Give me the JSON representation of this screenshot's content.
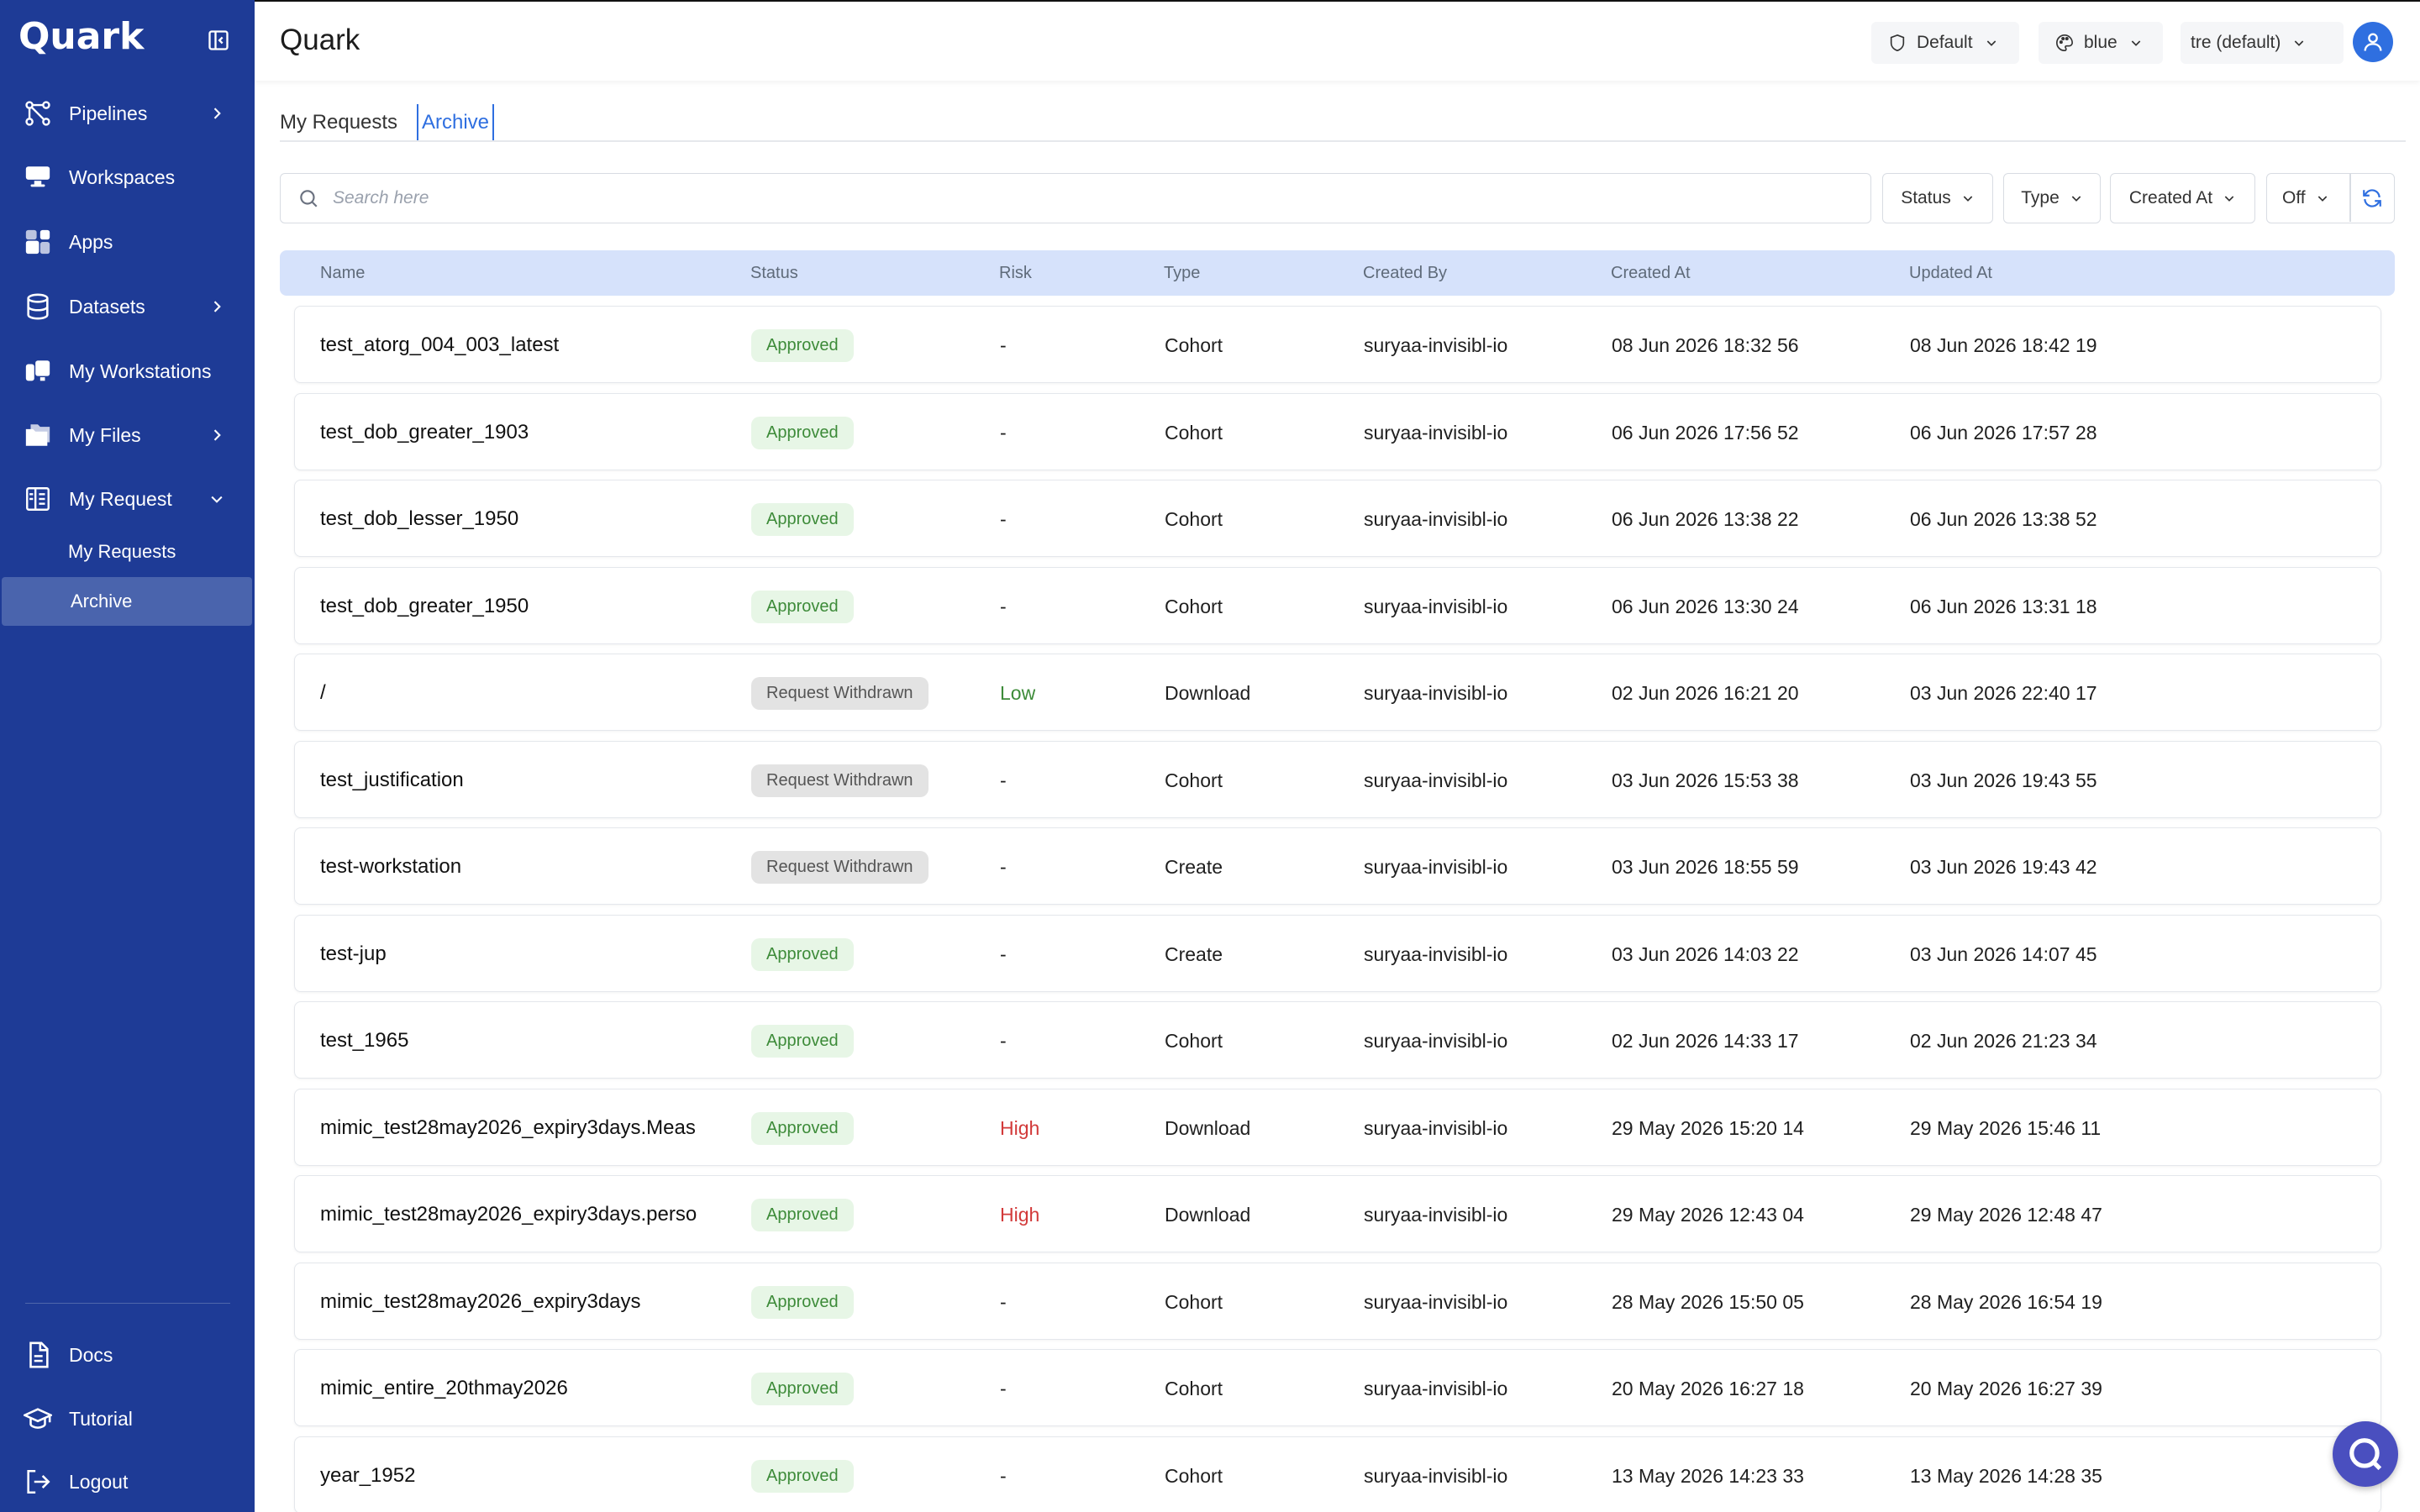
{
  "app": {
    "brand": "Quark",
    "page_title": "Quark"
  },
  "sidebar": {
    "items": [
      {
        "label": "Pipelines",
        "icon": "pipelines-icon",
        "expandable": true
      },
      {
        "label": "Workspaces",
        "icon": "workspaces-icon",
        "expandable": false
      },
      {
        "label": "Apps",
        "icon": "apps-icon",
        "expandable": false
      },
      {
        "label": "Datasets",
        "icon": "datasets-icon",
        "expandable": true
      },
      {
        "label": "My Workstations",
        "icon": "workstations-icon",
        "expandable": false
      },
      {
        "label": "My Files",
        "icon": "files-icon",
        "expandable": true
      },
      {
        "label": "My Request",
        "icon": "request-icon",
        "expandable": true,
        "expanded": true
      }
    ],
    "sub_items": [
      {
        "label": "My Requests",
        "active": false
      },
      {
        "label": "Archive",
        "active": true
      }
    ],
    "bottom_items": [
      {
        "label": "Docs",
        "icon": "docs-icon"
      },
      {
        "label": "Tutorial",
        "icon": "tutorial-icon"
      },
      {
        "label": "Logout",
        "icon": "logout-icon"
      }
    ]
  },
  "header": {
    "policy_select": "Default",
    "theme_select": "blue",
    "tenant_select": "tre (default)"
  },
  "tabs": [
    {
      "label": "My Requests",
      "active": false
    },
    {
      "label": "Archive",
      "active": true
    }
  ],
  "filters": {
    "search_placeholder": "Search here",
    "status": "Status",
    "type": "Type",
    "created_at": "Created At",
    "auto_refresh": "Off"
  },
  "table": {
    "columns": [
      "Name",
      "Status",
      "Risk",
      "Type",
      "Created By",
      "Created At",
      "Updated At"
    ],
    "rows": [
      {
        "name": "test_atorg_004_003_latest",
        "status": "Approved",
        "risk": "-",
        "type": "Cohort",
        "created_by": "suryaa-invisibl-io",
        "created_at": "08 Jun 2026 18:32 56",
        "updated_at": "08 Jun 2026 18:42 19"
      },
      {
        "name": "test_dob_greater_1903",
        "status": "Approved",
        "risk": "-",
        "type": "Cohort",
        "created_by": "suryaa-invisibl-io",
        "created_at": "06 Jun 2026 17:56 52",
        "updated_at": "06 Jun 2026 17:57 28"
      },
      {
        "name": "test_dob_lesser_1950",
        "status": "Approved",
        "risk": "-",
        "type": "Cohort",
        "created_by": "suryaa-invisibl-io",
        "created_at": "06 Jun 2026 13:38 22",
        "updated_at": "06 Jun 2026 13:38 52"
      },
      {
        "name": "test_dob_greater_1950",
        "status": "Approved",
        "risk": "-",
        "type": "Cohort",
        "created_by": "suryaa-invisibl-io",
        "created_at": "06 Jun 2026 13:30 24",
        "updated_at": "06 Jun 2026 13:31 18"
      },
      {
        "name": "/",
        "status": "Request Withdrawn",
        "risk": "Low",
        "type": "Download",
        "created_by": "suryaa-invisibl-io",
        "created_at": "02 Jun 2026 16:21 20",
        "updated_at": "03 Jun 2026 22:40 17"
      },
      {
        "name": "test_justification",
        "status": "Request Withdrawn",
        "risk": "-",
        "type": "Cohort",
        "created_by": "suryaa-invisibl-io",
        "created_at": "03 Jun 2026 15:53 38",
        "updated_at": "03 Jun 2026 19:43 55"
      },
      {
        "name": "test-workstation",
        "status": "Request Withdrawn",
        "risk": "-",
        "type": "Create",
        "created_by": "suryaa-invisibl-io",
        "created_at": "03 Jun 2026 18:55 59",
        "updated_at": "03 Jun 2026 19:43 42"
      },
      {
        "name": "test-jup",
        "status": "Approved",
        "risk": "-",
        "type": "Create",
        "created_by": "suryaa-invisibl-io",
        "created_at": "03 Jun 2026 14:03 22",
        "updated_at": "03 Jun 2026 14:07 45"
      },
      {
        "name": "test_1965",
        "status": "Approved",
        "risk": "-",
        "type": "Cohort",
        "created_by": "suryaa-invisibl-io",
        "created_at": "02 Jun 2026 14:33 17",
        "updated_at": "02 Jun 2026 21:23 34"
      },
      {
        "name": "mimic_test28may2026_expiry3days.Meas",
        "status": "Approved",
        "risk": "High",
        "type": "Download",
        "created_by": "suryaa-invisibl-io",
        "created_at": "29 May 2026 15:20 14",
        "updated_at": "29 May 2026 15:46 11"
      },
      {
        "name": "mimic_test28may2026_expiry3days.perso",
        "status": "Approved",
        "risk": "High",
        "type": "Download",
        "created_by": "suryaa-invisibl-io",
        "created_at": "29 May 2026 12:43 04",
        "updated_at": "29 May 2026 12:48 47"
      },
      {
        "name": "mimic_test28may2026_expiry3days",
        "status": "Approved",
        "risk": "-",
        "type": "Cohort",
        "created_by": "suryaa-invisibl-io",
        "created_at": "28 May 2026 15:50 05",
        "updated_at": "28 May 2026 16:54 19"
      },
      {
        "name": "mimic_entire_20thmay2026",
        "status": "Approved",
        "risk": "-",
        "type": "Cohort",
        "created_by": "suryaa-invisibl-io",
        "created_at": "20 May 2026 16:27 18",
        "updated_at": "20 May 2026 16:27 39"
      },
      {
        "name": "year_1952",
        "status": "Approved",
        "risk": "-",
        "type": "Cohort",
        "created_by": "suryaa-invisibl-io",
        "created_at": "13 May 2026 14:23 33",
        "updated_at": "13 May 2026 14:28 35"
      }
    ]
  },
  "colors": {
    "sidebar_bg": "#1e3b96",
    "accent": "#2f6fe0",
    "approved": "#3d8b39",
    "high_risk": "#d23a3a"
  }
}
